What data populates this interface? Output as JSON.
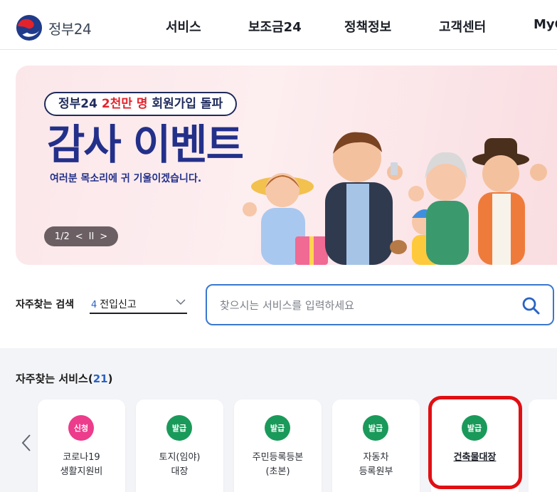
{
  "header": {
    "logo_text": "정부24",
    "nav": [
      "서비스",
      "보조금24",
      "정책정보",
      "고객센터",
      "MyG"
    ]
  },
  "banner": {
    "pill_prefix": "정부24 ",
    "pill_highlight": "2천만 명",
    "pill_suffix": " 회원가입 돌파",
    "headline": "감사 이벤트",
    "subline": "여러분 목소리에 귀 기울이겠습니다.",
    "pager_text": "1/2",
    "pager_prev": "<",
    "pager_pause": "II",
    "pager_next": ">"
  },
  "search": {
    "frequent_label": "자주찾는 검색",
    "frequent_rank": "4",
    "frequent_term": "전입신고",
    "placeholder": "찾으시는 서비스를 입력하세요"
  },
  "services": {
    "title": "자주찾는 서비스(",
    "count": "21",
    "title_close": ")",
    "cards": [
      {
        "badge": "신청",
        "type": "apply",
        "line1": "코로나19",
        "line2": "생활지원비"
      },
      {
        "badge": "발급",
        "type": "issue",
        "line1": "토지(임야)",
        "line2": "대장"
      },
      {
        "badge": "발급",
        "type": "issue",
        "line1": "주민등록등본",
        "line2": "(초본)"
      },
      {
        "badge": "발급",
        "type": "issue",
        "line1": "자동차",
        "line2": "등록원부"
      },
      {
        "badge": "발급",
        "type": "issue",
        "line1": "건축물대장",
        "line2": ""
      }
    ]
  },
  "colors": {
    "brand_navy": "#23308a",
    "accent_blue": "#3a78cf",
    "apply_pink": "#ec3c8b",
    "issue_green": "#1a9a5a",
    "highlight_red": "#e10f13"
  }
}
